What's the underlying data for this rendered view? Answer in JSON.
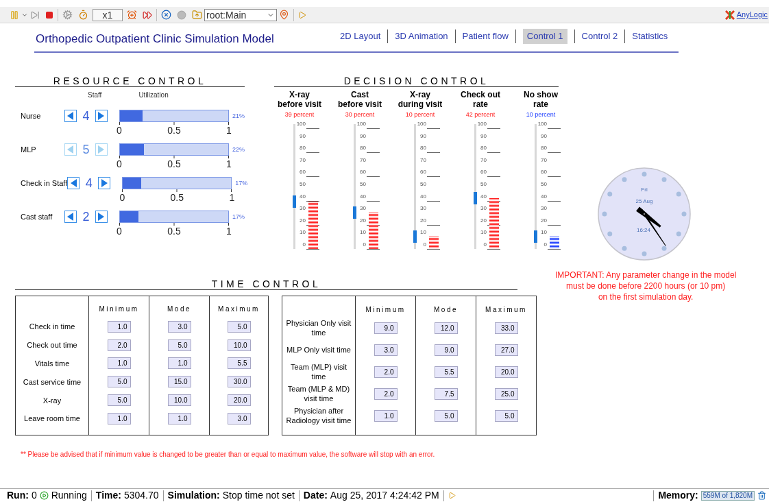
{
  "toolbar": {
    "speed": "x1",
    "scope": "root:Main",
    "brand": "AnyLogic"
  },
  "title": "Orthopedic Outpatient Clinic Simulation Model",
  "nav_tabs": [
    {
      "label": "2D Layout",
      "selected": false
    },
    {
      "label": "3D Animation",
      "selected": false
    },
    {
      "label": "Patient flow",
      "selected": false
    },
    {
      "label": "Control 1",
      "selected": true
    },
    {
      "label": "Control 2",
      "selected": false
    },
    {
      "label": "Statistics",
      "selected": false
    }
  ],
  "resource_control": {
    "heading": "RESOURCE CONTROL",
    "staff_header": "Staff",
    "utilization_header": "Utilization",
    "rows": [
      {
        "name": "Nurse",
        "count": "4",
        "disabled": false,
        "level": 0.21,
        "reading": "21%",
        "ticks": [
          "0",
          "0.5",
          "1"
        ]
      },
      {
        "name": "MLP",
        "count": "5",
        "disabled": true,
        "level": 0.22,
        "reading": "22%",
        "ticks": [
          "0",
          "0.5",
          "1"
        ]
      },
      {
        "name": "Check in Staff",
        "count": "4",
        "disabled": false,
        "level": 0.17,
        "reading": "17%",
        "ticks": [
          "0",
          "0.5",
          "1"
        ]
      },
      {
        "name": "Cast staff",
        "count": "2",
        "disabled": false,
        "level": 0.17,
        "reading": "17%",
        "ticks": [
          "0",
          "0.5",
          "1"
        ]
      }
    ]
  },
  "decision_control": {
    "heading": "DECISION CONTROL",
    "columns": [
      {
        "title": [
          "X-ray",
          "before visit"
        ],
        "reading": "39 percent",
        "color": "#ff2020",
        "level": 0.39,
        "scale": [
          "100",
          "90",
          "80",
          "70",
          "60",
          "50",
          "40",
          "30",
          "20",
          "10",
          "0"
        ]
      },
      {
        "title": [
          "Cast",
          "before visit"
        ],
        "reading": "30 percent",
        "color": "#ff2020",
        "level": 0.3,
        "scale": [
          "100",
          "90",
          "80",
          "70",
          "60",
          "50",
          "40",
          "30",
          "20",
          "10",
          "0"
        ]
      },
      {
        "title": [
          "X-ray",
          "during visit"
        ],
        "reading": "10 percent",
        "color": "#ff2020",
        "level": 0.1,
        "scale": [
          "100",
          "90",
          "80",
          "70",
          "60",
          "50",
          "40",
          "30",
          "20",
          "10",
          "0"
        ]
      },
      {
        "title": [
          "Check out",
          "rate"
        ],
        "reading": "42 percent",
        "color": "#ff2020",
        "level": 0.42,
        "scale": [
          "100",
          "90",
          "80",
          "70",
          "60",
          "50",
          "40",
          "30",
          "20",
          "10",
          "0"
        ]
      },
      {
        "title": [
          "No show",
          "rate"
        ],
        "reading": "10 percent",
        "color": "#2040ff",
        "level": 0.1,
        "scale": [
          "100",
          "90",
          "80",
          "70",
          "60",
          "50",
          "40",
          "30",
          "20",
          "10",
          "0"
        ]
      }
    ]
  },
  "clock": {
    "day": "Fri",
    "date": "25 Aug",
    "time": "16:24"
  },
  "notice": [
    "IMPORTANT: Any parameter change in the model",
    "must be done before 2200 hours (or 10 pm)",
    "on the first simulation day."
  ],
  "time_control": {
    "heading": "TIME CONTROL",
    "tables": [
      {
        "columns": [
          "Minimum",
          "Mode",
          "Maximum"
        ],
        "rows": [
          {
            "label": "Check in time",
            "values": [
              "1.0",
              "3.0",
              "5.0"
            ]
          },
          {
            "label": "Check out time",
            "values": [
              "2.0",
              "5.0",
              "10.0"
            ]
          },
          {
            "label": "Vitals time",
            "values": [
              "1.0",
              "1.0",
              "5.5"
            ]
          },
          {
            "label": "Cast service time",
            "values": [
              "5.0",
              "15.0",
              "30.0"
            ]
          },
          {
            "label": "X-ray",
            "values": [
              "5.0",
              "10.0",
              "20.0"
            ]
          },
          {
            "label": "Leave room time",
            "values": [
              "1.0",
              "1.0",
              "3.0"
            ]
          }
        ]
      },
      {
        "columns": [
          "Minimum",
          "Mode",
          "Maximum"
        ],
        "rows": [
          {
            "label": "Physician Only visit time",
            "values": [
              "9.0",
              "12.0",
              "33.0"
            ]
          },
          {
            "label": "MLP Only visit time",
            "values": [
              "3.0",
              "9.0",
              "27.0"
            ]
          },
          {
            "label": "Team (MLP) visit time",
            "values": [
              "2.0",
              "5.5",
              "20.0"
            ]
          },
          {
            "label": "Team (MLP & MD) visit time",
            "values": [
              "2.0",
              "7.5",
              "25.0"
            ]
          },
          {
            "label": "Physician after Radiology visit time",
            "values": [
              "1.0",
              "5.0",
              "5.0"
            ]
          }
        ]
      }
    ]
  },
  "footnote": "** Please be advised that if minimum value is changed to be greater than or equal to maximum value, the software will stop with an error.",
  "status_bar": {
    "run": {
      "label": "Run:",
      "count": "0",
      "state": "Running"
    },
    "time": {
      "label": "Time:",
      "value": "5304.70"
    },
    "simulation": {
      "label": "Simulation:",
      "value": "Stop time not set"
    },
    "date": {
      "label": "Date:",
      "value": "Aug 25, 2017 4:24:42 PM"
    },
    "memory": {
      "label": "Memory:",
      "value": "559M of 1,820M"
    }
  }
}
